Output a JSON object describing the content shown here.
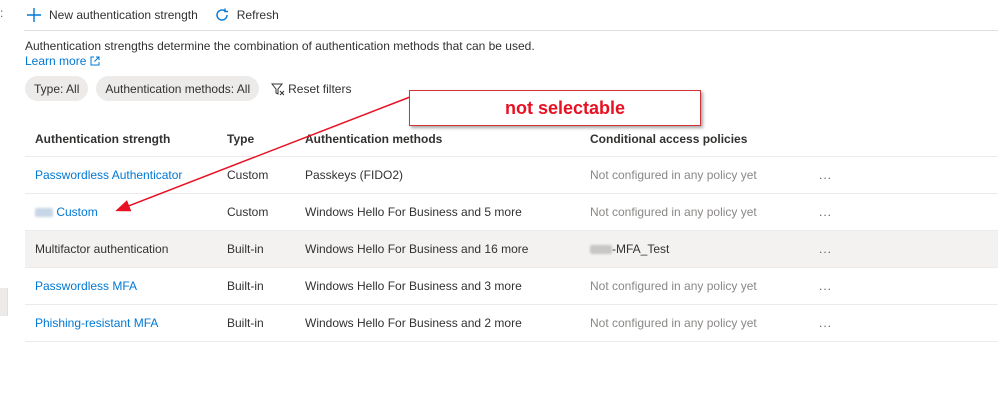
{
  "toolbar": {
    "new_label": "New authentication strength",
    "refresh_label": "Refresh"
  },
  "description": "Authentication strengths determine the combination of authentication methods that can be used.",
  "learn_more": "Learn more",
  "filters": {
    "type_pill": "Type: All",
    "methods_pill": "Authentication methods: All",
    "reset_label": "Reset filters"
  },
  "table": {
    "headers": [
      "Authentication strength",
      "Type",
      "Authentication methods",
      "Conditional access policies"
    ],
    "rows": [
      {
        "name": "Passwordless Authenticator",
        "type": "Custom",
        "methods": "Passkeys (FIDO2)",
        "policies": "Not configured in any policy yet",
        "more": "..."
      },
      {
        "name": "Custom",
        "type": "Custom",
        "methods": "Windows Hello For Business and 5 more",
        "policies": "Not configured in any policy yet",
        "more": "..."
      },
      {
        "name": "Multifactor authentication",
        "type": "Built-in",
        "methods": "Windows Hello For Business and 16 more",
        "policies": "-MFA_Test",
        "more": "..."
      },
      {
        "name": "Passwordless MFA",
        "type": "Built-in",
        "methods": "Windows Hello For Business and 3 more",
        "policies": "Not configured in any policy yet",
        "more": "..."
      },
      {
        "name": "Phishing-resistant MFA",
        "type": "Built-in",
        "methods": "Windows Hello For Business and 2 more",
        "policies": "Not configured in any policy yet",
        "more": "..."
      }
    ]
  },
  "annotation": {
    "text": "not selectable",
    "color": "#e81123"
  },
  "colors": {
    "accent": "#0078d4",
    "selected_row": "#f3f2f1"
  }
}
